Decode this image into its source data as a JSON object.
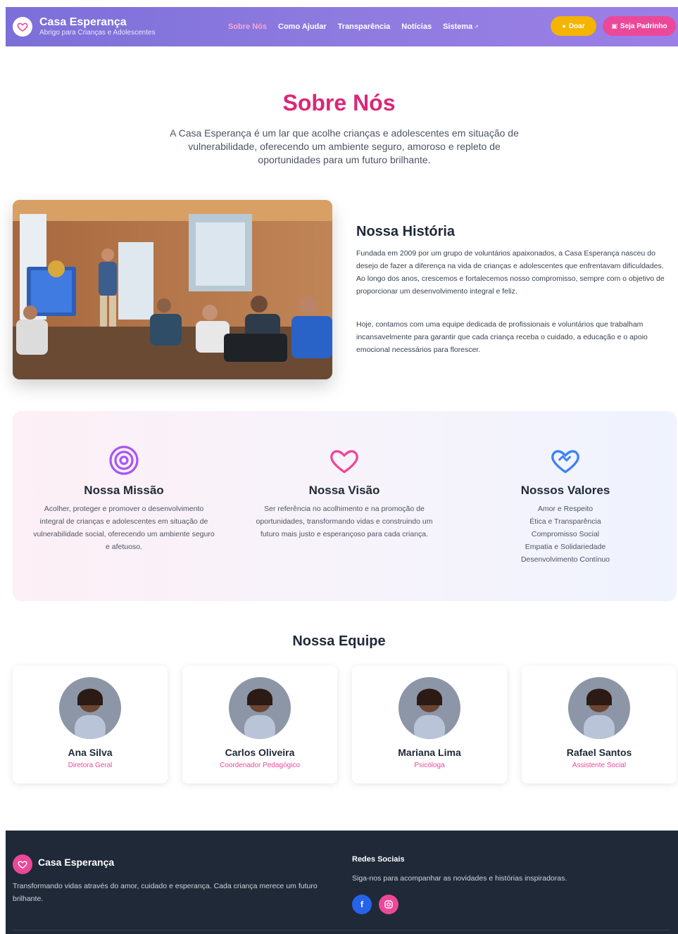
{
  "header": {
    "brand_title": "Casa Esperança",
    "brand_subtitle": "Abrigo para Crianças e Adolescentes",
    "nav": [
      "Sobre Nós",
      "Como Ajudar",
      "Transparência",
      "Notícias",
      "Sistema"
    ],
    "active_nav": "Sobre Nós",
    "btn_doar": "Doar",
    "btn_padrinho": "Seja Padrinho"
  },
  "hero": {
    "title": "Sobre Nós",
    "text": "A Casa Esperança é um lar que acolhe crianças e adolescentes em situação de vulnerabilidade, oferecendo um ambiente seguro, amoroso e repleto de oportunidades para um futuro brilhante."
  },
  "history": {
    "title": "Nossa História",
    "p1": "Fundada em 2009 por um grupo de voluntários apaixonados, a Casa Esperança nasceu do desejo de fazer a diferença na vida de crianças e adolescentes que enfrentavam dificuldades. Ao longo dos anos, crescemos e fortalecemos nosso compromisso, sempre com o objetivo de proporcionar um desenvolvimento integral e feliz.",
    "p2": "Hoje, contamos com uma equipe dedicada de profissionais e voluntários que trabalham incansavelmente para garantir que cada criança receba o cuidado, a educação e o apoio emocional necessários para florescer."
  },
  "mission": {
    "missao_title": "Nossa Missão",
    "missao_text": "Acolher, proteger e promover o desenvolvimento integral de crianças e adolescentes em situação de vulnerabilidade social, oferecendo um ambiente seguro e afetuoso.",
    "visao_title": "Nossa Visão",
    "visao_text": "Ser referência no acolhimento e na promoção de oportunidades, transformando vidas e construindo um futuro mais justo e esperançoso para cada criança.",
    "valores_title": "Nossos Valores",
    "valores": [
      "Amor e Respeito",
      "Ética e Transparência",
      "Compromisso Social",
      "Empatia e Solidariedade",
      "Desenvolvimento Contínuo"
    ]
  },
  "team": {
    "title": "Nossa Equipe",
    "members": [
      {
        "name": "Ana Silva",
        "role": "Diretora Geral"
      },
      {
        "name": "Carlos Oliveira",
        "role": "Coordenador Pedagógico"
      },
      {
        "name": "Mariana Lima",
        "role": "Psicóloga"
      },
      {
        "name": "Rafael Santos",
        "role": "Assistente Social"
      }
    ]
  },
  "footer": {
    "brand": "Casa Esperança",
    "desc": "Transformando vidas através do amor, cuidado e esperança. Cada criança merece um futuro brilhante.",
    "social_title": "Redes Sociais",
    "social_text": "Siga-nos para acompanhar as novidades e histórias inspiradoras.",
    "facebook_label": "f"
  },
  "colors": {
    "accent": "#db2777",
    "header_start": "#7b6fd8",
    "header_end": "#9b7fe6",
    "doar": "#f5b400",
    "padrinho": "#ec4899",
    "footer_bg": "#1f2937"
  }
}
